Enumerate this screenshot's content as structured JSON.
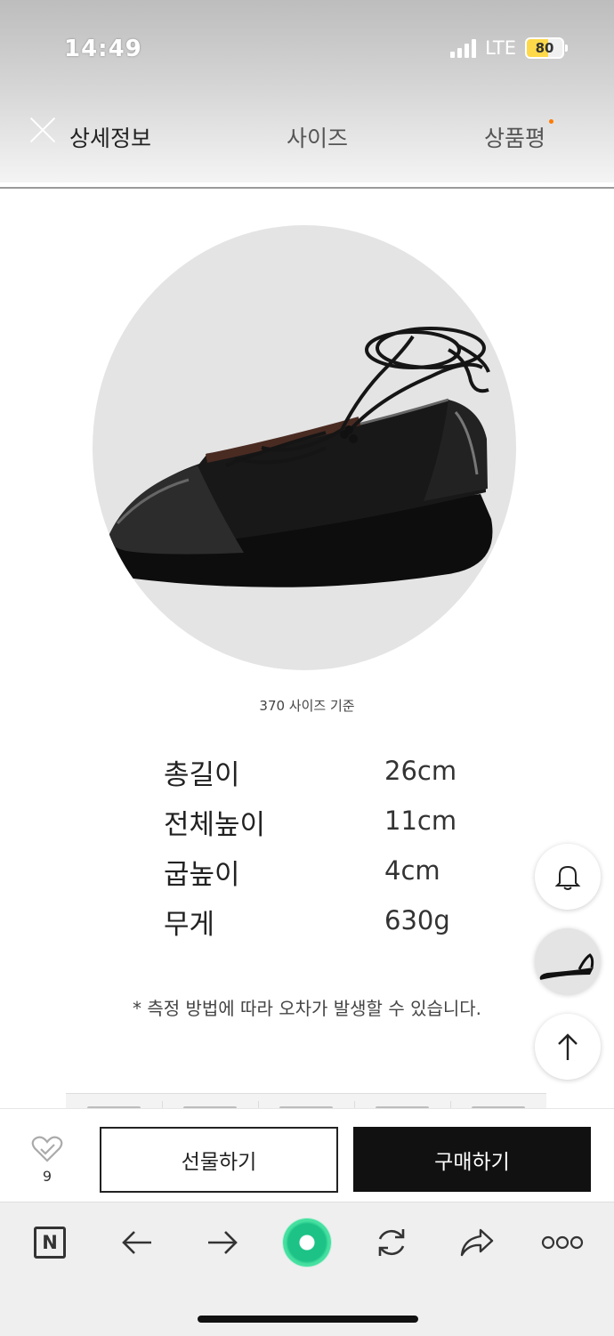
{
  "status_bar": {
    "time": "14:49",
    "network": "LTE",
    "battery": "80"
  },
  "tabs": [
    {
      "label": "상세정보",
      "active": true
    },
    {
      "label": "사이즈",
      "active": false
    },
    {
      "label": "상품평",
      "active": false,
      "has_new_dot": true
    }
  ],
  "product": {
    "caption": "370 사이즈 기준",
    "specs": [
      {
        "label": "총길이",
        "value": "26cm"
      },
      {
        "label": "전체높이",
        "value": "11cm"
      },
      {
        "label": "굽높이",
        "value": "4cm"
      },
      {
        "label": "무게",
        "value": "630g"
      }
    ],
    "notice": "* 측정 방법에 따라 오차가 발생할 수 있습니다."
  },
  "floating": {
    "icons": [
      "bell-icon",
      "product-thumbnail",
      "arrow-up-icon"
    ]
  },
  "actions": {
    "like_count": "9",
    "gift_label": "선물하기",
    "buy_label": "구매하기"
  },
  "browser": {
    "icons": [
      "naver-n-icon",
      "back-arrow-icon",
      "forward-arrow-icon",
      "green-orb-icon",
      "refresh-icon",
      "share-icon",
      "more-icon"
    ]
  },
  "colors": {
    "buy_button": "#111111",
    "orb": "#1cc286",
    "tab_dot": "#ff7a00"
  }
}
